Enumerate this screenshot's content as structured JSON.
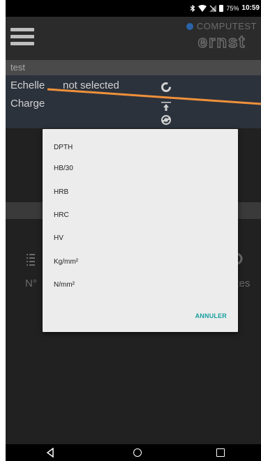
{
  "status": {
    "battery": "75%",
    "time": "10:59"
  },
  "brand": {
    "name": "COMPUTEST",
    "logo_text": "ernst"
  },
  "test_title": "test",
  "params": {
    "scale_label": "Echelle",
    "scale_value": "not selected",
    "charge_label": "Charge"
  },
  "bottom": {
    "left_label": "N°",
    "right_label": "otes"
  },
  "dialog": {
    "items": [
      "DPTH",
      "HB/30",
      "HRB",
      "HRC",
      "HV",
      "Kg/mm²",
      "N/mm²"
    ],
    "cancel": "ANNULER"
  },
  "colors": {
    "accent": "#189e9e",
    "orange": "#f0913a",
    "brand_dot": "#2a63a7"
  },
  "icons": {
    "menu": "hamburger-icon",
    "refresh": "refresh-icon",
    "upload": "upload-icon",
    "sync": "sync-icon",
    "list": "list-icon",
    "search": "search-icon",
    "back": "back-icon",
    "home": "home-icon",
    "recents": "recents-icon"
  }
}
